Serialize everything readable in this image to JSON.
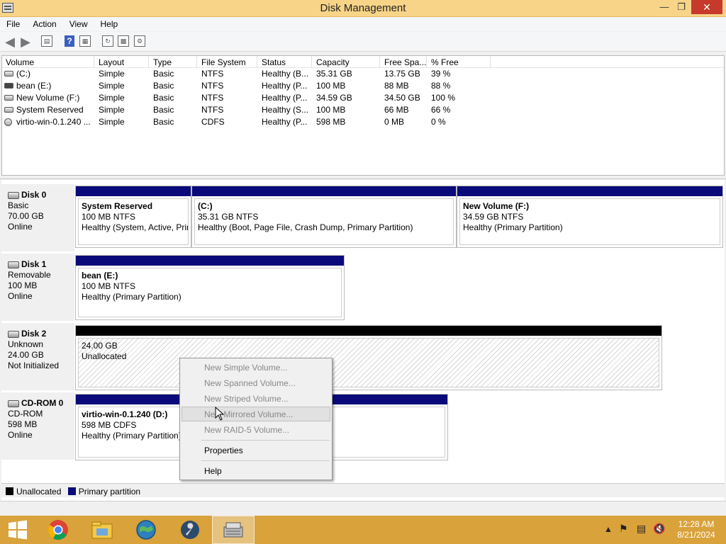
{
  "window": {
    "title": "Disk Management",
    "minimize_glyph": "—",
    "maximize_glyph": "❐",
    "close_glyph": "✕"
  },
  "menu": {
    "items": [
      "File",
      "Action",
      "View",
      "Help"
    ]
  },
  "toolbar": {
    "icons": [
      "back-arrow-icon",
      "forward-arrow-icon",
      "console-tree-icon",
      "help-icon",
      "properties-icon",
      "refresh-icon",
      "rescan-disks-icon",
      "settings-icon"
    ]
  },
  "volume_list": {
    "columns": [
      "Volume",
      "Layout",
      "Type",
      "File System",
      "Status",
      "Capacity",
      "Free Spa...",
      "% Free"
    ],
    "rows": [
      [
        "(C:)",
        "Simple",
        "Basic",
        "NTFS",
        "Healthy (B...",
        "35.31 GB",
        "13.75 GB",
        "39 %"
      ],
      [
        "bean (E:)",
        "Simple",
        "Basic",
        "NTFS",
        "Healthy (P...",
        "100 MB",
        "88 MB",
        "88 %"
      ],
      [
        "New Volume (F:)",
        "Simple",
        "Basic",
        "NTFS",
        "Healthy (P...",
        "34.59 GB",
        "34.50 GB",
        "100 %"
      ],
      [
        "System Reserved",
        "Simple",
        "Basic",
        "NTFS",
        "Healthy (S...",
        "100 MB",
        "66 MB",
        "66 %"
      ],
      [
        "virtio-win-0.1.240 ...",
        "Simple",
        "Basic",
        "CDFS",
        "Healthy (P...",
        "598 MB",
        "0 MB",
        "0 %"
      ]
    ]
  },
  "disks": [
    {
      "name": "Disk 0",
      "type": "Basic",
      "size": "70.00 GB",
      "status": "Online",
      "partitions": [
        {
          "name": "System Reserved",
          "size": "100 MB NTFS",
          "status": "Healthy (System, Active, Prir"
        },
        {
          "name": "(C:)",
          "size": "35.31 GB NTFS",
          "status": "Healthy (Boot, Page File, Crash Dump, Primary Partition)"
        },
        {
          "name": "New Volume  (F:)",
          "size": "34.59 GB NTFS",
          "status": "Healthy (Primary Partition)"
        }
      ]
    },
    {
      "name": "Disk 1",
      "type": "Removable",
      "size": "100 MB",
      "status": "Online",
      "partitions": [
        {
          "name": "bean  (E:)",
          "size": "100 MB NTFS",
          "status": "Healthy (Primary Partition)"
        }
      ]
    },
    {
      "name": "Disk 2",
      "type": "Unknown",
      "size": "24.00 GB",
      "status": "Not Initialized",
      "partitions": [
        {
          "name": "",
          "size": "24.00 GB",
          "status": "Unallocated"
        }
      ]
    },
    {
      "name": "CD-ROM 0",
      "type": "CD-ROM",
      "size": "598 MB",
      "status": "Online",
      "partitions": [
        {
          "name": "virtio-win-0.1.240  (D:)",
          "size": "598 MB CDFS",
          "status": "Healthy (Primary Partition)"
        }
      ]
    }
  ],
  "legend": {
    "items": [
      {
        "label": "Unallocated",
        "color": "#000000"
      },
      {
        "label": "Primary partition",
        "color": "#0a0a7a"
      }
    ]
  },
  "context_menu": {
    "items": [
      {
        "label": "New Simple Volume...",
        "enabled": false
      },
      {
        "label": "New Spanned Volume...",
        "enabled": false
      },
      {
        "label": "New Striped Volume...",
        "enabled": false
      },
      {
        "label": "New Mirrored Volume...",
        "enabled": false,
        "hovered": true
      },
      {
        "label": "New RAID-5 Volume...",
        "enabled": false
      },
      {
        "label": "Properties",
        "enabled": true
      },
      {
        "label": "Help",
        "enabled": true
      }
    ]
  },
  "taskbar": {
    "apps": [
      "start-icon",
      "chrome-icon",
      "file-explorer-icon",
      "network-globe-icon",
      "tools-wrench-icon",
      "disk-management-icon"
    ],
    "time": "12:28 AM",
    "date": "8/21/2024"
  },
  "colors": {
    "titlebar": "#f7d488",
    "taskbar": "#d9a23b",
    "primary_partition": "#0a0a7a",
    "unallocated": "#000000"
  }
}
